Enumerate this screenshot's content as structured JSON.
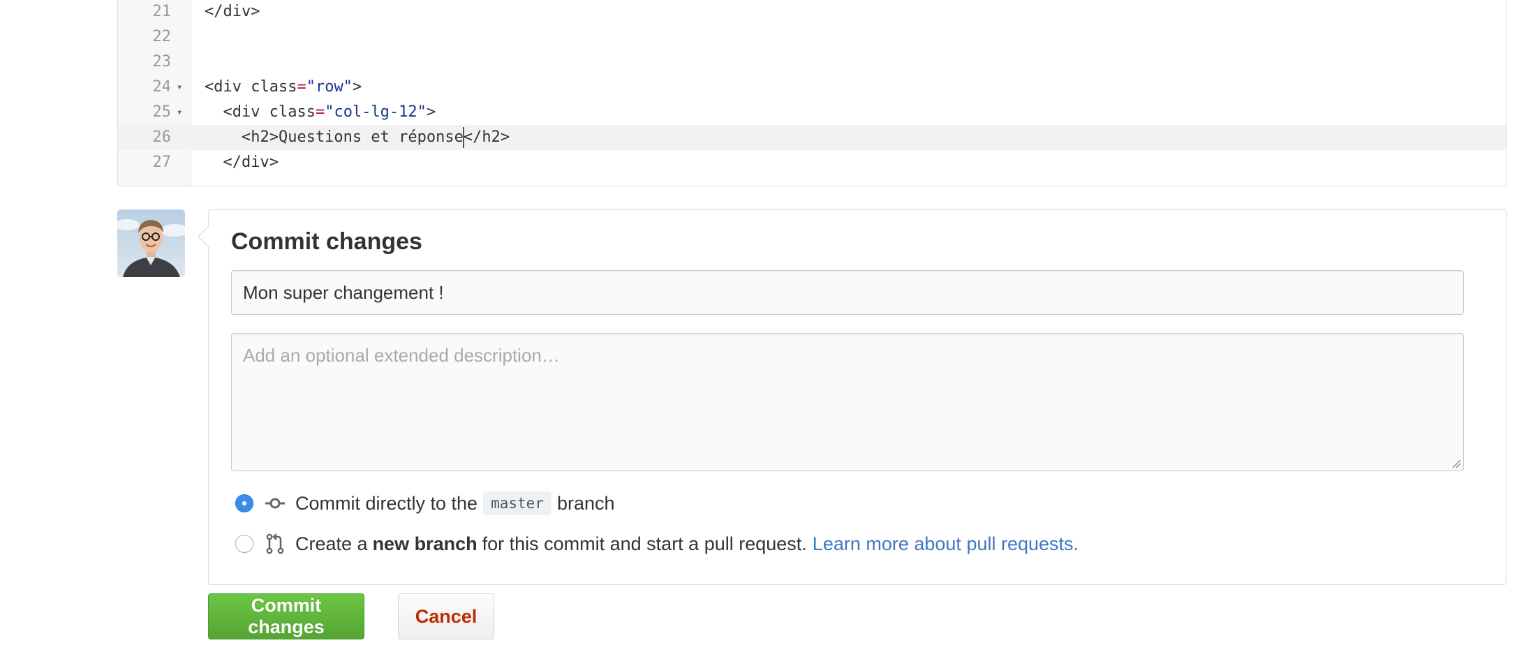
{
  "editor": {
    "lines": [
      {
        "num": "21",
        "fold": false,
        "parts": [
          {
            "t": "</div>"
          }
        ]
      },
      {
        "num": "22",
        "fold": false,
        "parts": []
      },
      {
        "num": "23",
        "fold": false,
        "parts": []
      },
      {
        "num": "24",
        "fold": true,
        "parts": [
          {
            "t": "<div class"
          },
          {
            "t": "=",
            "k": "eq"
          },
          {
            "t": "\"row\"",
            "k": "str"
          },
          {
            "t": ">"
          }
        ]
      },
      {
        "num": "25",
        "fold": true,
        "parts": [
          {
            "t": "  <div class"
          },
          {
            "t": "=",
            "k": "eq"
          },
          {
            "t": "\"col-lg-12\"",
            "k": "str"
          },
          {
            "t": ">"
          }
        ]
      },
      {
        "num": "26",
        "fold": false,
        "active": true,
        "parts": [
          {
            "t": "    <h2>Questions et réponse"
          },
          {
            "cursor": true
          },
          {
            "t": "</h2>"
          }
        ]
      },
      {
        "num": "27",
        "fold": false,
        "parts": [
          {
            "t": "  </div>"
          }
        ]
      }
    ]
  },
  "commit": {
    "title": "Commit changes",
    "summary_value": "Mon super changement !",
    "description_placeholder": "Add an optional extended description…",
    "option_direct": {
      "prefix": "Commit directly to the",
      "branch": "master",
      "suffix": "branch"
    },
    "option_new_branch": {
      "prefix": "Create a",
      "bold": "new branch",
      "suffix": "for this commit and start a pull request.",
      "link": "Learn more about pull requests."
    },
    "selected_option": "direct"
  },
  "buttons": {
    "commit_label": "Commit changes",
    "cancel_label": "Cancel"
  },
  "colors": {
    "primary_green": "#55a532",
    "cancel_red": "#bd2c00",
    "link_blue": "#4078c0",
    "radio_blue": "#3b8de8"
  },
  "icons": {
    "option_direct": "git-commit-icon",
    "option_new_branch": "git-pull-request-icon"
  }
}
